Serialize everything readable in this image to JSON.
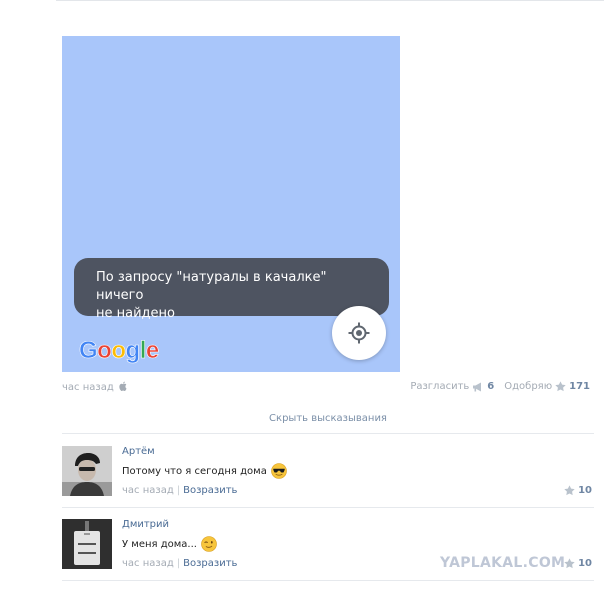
{
  "map": {
    "toast_line1": "По запросу \"натуралы в качалке\" ничего",
    "toast_line2": "не найдено",
    "logo_letters": [
      "G",
      "o",
      "o",
      "g",
      "l",
      "e"
    ],
    "background_color": "#a9c6fa",
    "locate_icon": "my-location-icon"
  },
  "post": {
    "time": "час назад",
    "platform_icon": "apple-icon",
    "dislike_label": "Разгласить",
    "dislike_count": "6",
    "like_label": "Одобряю",
    "like_count": "171"
  },
  "hide_comments_label": "Скрыть высказывания",
  "comments": [
    {
      "author": "Артём",
      "text": "Потому что я сегодня дома",
      "emoji": "sunglasses-emoji",
      "time": "час назад",
      "reply_label": "Возразить",
      "likes": "10"
    },
    {
      "author": "Дмитрий",
      "text": "У меня дома...",
      "emoji": "wink-emoji",
      "time": "час назад",
      "reply_label": "Возразить",
      "likes": "10"
    }
  ],
  "watermark": "YAPLAKAL.COM"
}
